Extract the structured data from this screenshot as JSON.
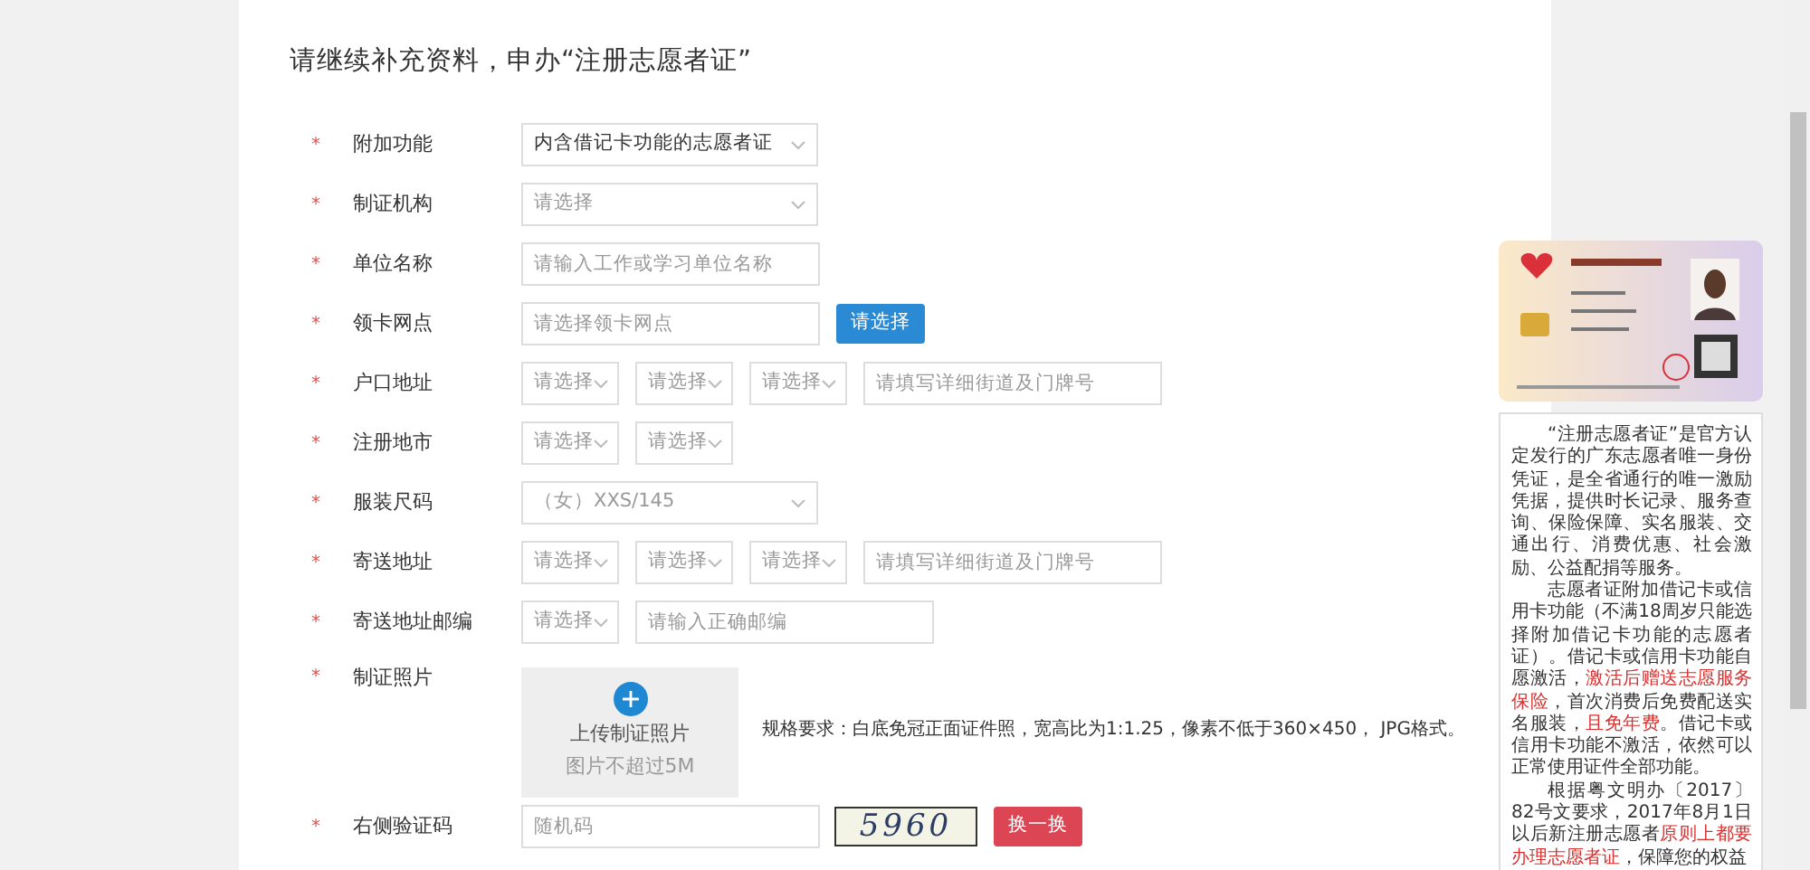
{
  "heading": "请继续补充资料，申办“注册志愿者证”",
  "fields": [
    {
      "label": "附加功能",
      "marker": "*",
      "controls": [
        {
          "kind": "dropdown",
          "value": "内含借记卡功能的志愿者证",
          "disabled": false
        }
      ]
    },
    {
      "label": "制证机构",
      "marker": "*",
      "controls": [
        {
          "kind": "dropdown",
          "placeholder": "请选择"
        }
      ]
    },
    {
      "label": "单位名称",
      "marker": "*",
      "controls": [
        {
          "kind": "input",
          "placeholder": "请输入工作或学习单位名称"
        }
      ]
    },
    {
      "label": "领卡网点",
      "marker": "*",
      "controls": [
        {
          "kind": "input",
          "placeholder": "请选择领卡网点"
        },
        {
          "kind": "button",
          "color": "#2a8bd4",
          "label": "请选择"
        }
      ]
    },
    {
      "label": "户口地址",
      "marker": "*",
      "controls": [
        {
          "kind": "picker",
          "placeholder": "请选择"
        },
        {
          "kind": "picker",
          "placeholder": "请选择"
        },
        {
          "kind": "picker",
          "placeholder": "请选择"
        },
        {
          "kind": "input",
          "placeholder": "请填写详细街道及门牌号"
        }
      ]
    },
    {
      "label": "注册地市",
      "marker": "*",
      "controls": [
        {
          "kind": "picker",
          "placeholder": "请选择"
        },
        {
          "kind": "picker",
          "placeholder": "请选择"
        }
      ]
    },
    {
      "label": "服装尺码",
      "marker": "*",
      "controls": [
        {
          "kind": "dropdown",
          "value": "（女）XXS/145",
          "disabled": true
        }
      ]
    },
    {
      "label": "寄送地址",
      "marker": "*",
      "controls": [
        {
          "kind": "picker",
          "placeholder": "请选择"
        },
        {
          "kind": "picker",
          "placeholder": "请选择"
        },
        {
          "kind": "picker",
          "placeholder": "请选择"
        },
        {
          "kind": "input",
          "placeholder": "请填写详细街道及门牌号"
        }
      ]
    },
    {
      "label": "寄送地址邮编",
      "marker": "*",
      "controls": [
        {
          "kind": "picker",
          "placeholder": "请选择"
        },
        {
          "kind": "input",
          "placeholder": "请输入正确邮编"
        }
      ]
    },
    {
      "label": "制证照片",
      "marker": "*",
      "controls": [
        {
          "kind": "upload",
          "title": "上传制证照片",
          "note": "图片不超过5M"
        },
        {
          "kind": "hint",
          "text": "规格要求：白底免冠正面证件照，宽高比为1:1.25，像素不低于360×450， JPG格式。"
        }
      ]
    },
    {
      "label": "右侧验证码",
      "marker": "*",
      "controls": [
        {
          "kind": "input",
          "placeholder": "随机码"
        },
        {
          "kind": "captcha",
          "code": "5960"
        },
        {
          "kind": "button",
          "color": "#dc4553",
          "label": "换一换"
        }
      ]
    }
  ],
  "side_panel": {
    "card": {
      "kind": "picture"
    },
    "paragraphs": [
      [
        {
          "text": "“注册志愿者证”是官方认定发行的广东志愿者唯一身份凭证，是全省通行的唯一激励凭据，提供时长记录、服务查询、保险保障、实名服装、交通出行、消费优惠、社会激励、公益配捐等服务。",
          "highlight": false
        }
      ],
      [
        {
          "text": "志愿者证附加借记卡或信用卡功能（不满18周岁只能选择附加借记卡功能的志愿者证）。借记卡或信用卡功能自愿激活，",
          "highlight": false
        },
        {
          "text": "激活后赠送志愿服务保险",
          "highlight": true
        },
        {
          "text": "，首次消费后免费配送实名服装，",
          "highlight": false
        },
        {
          "text": "且免年费",
          "highlight": true
        },
        {
          "text": "。借记卡或信用卡功能不激活，依然可以正常使用证件全部功能。",
          "highlight": false
        }
      ],
      [
        {
          "text": "根据粤文明办〔2017〕82号文要求，2017年8月1日以后新注册志愿者",
          "highlight": false
        },
        {
          "text": "原则上都要办理志愿者证",
          "highlight": true
        },
        {
          "text": "，保障您的权益",
          "highlight": false
        }
      ]
    ]
  }
}
